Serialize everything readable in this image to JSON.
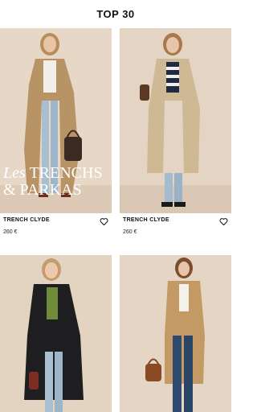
{
  "header": {
    "title": "TOP 30"
  },
  "promo": {
    "prefix": "Les",
    "line1": "TRENCHS",
    "line2": "& PARKAS"
  },
  "products": [
    {
      "name": "TRENCH CLYDE",
      "price": "260 €",
      "favorite_icon": "heart-outline-icon"
    },
    {
      "name": "TRENCH CLYDE",
      "price": "260 €",
      "favorite_icon": "heart-outline-icon"
    }
  ],
  "colors": {
    "background": "#ffffff",
    "photo_backdrop": "#e3d5c5",
    "text": "#111111"
  }
}
